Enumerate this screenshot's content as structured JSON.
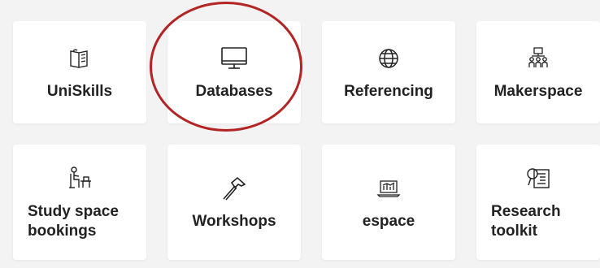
{
  "colors": {
    "background": "#f3f3f3",
    "tile": "#ffffff",
    "text": "#222222",
    "annotation": "#b32424"
  },
  "tiles": [
    {
      "label": "UniSkills",
      "icon": "book-open-icon"
    },
    {
      "label": "Databases",
      "icon": "monitor-icon"
    },
    {
      "label": "Referencing",
      "icon": "globe-icon"
    },
    {
      "label": "Makerspace",
      "icon": "people-network-icon"
    },
    {
      "label": "Study space bookings",
      "icon": "desk-person-icon"
    },
    {
      "label": "Workshops",
      "icon": "hammer-icon"
    },
    {
      "label": "espace",
      "icon": "laptop-chart-icon"
    },
    {
      "label": "Research toolkit",
      "icon": "search-document-icon"
    }
  ]
}
